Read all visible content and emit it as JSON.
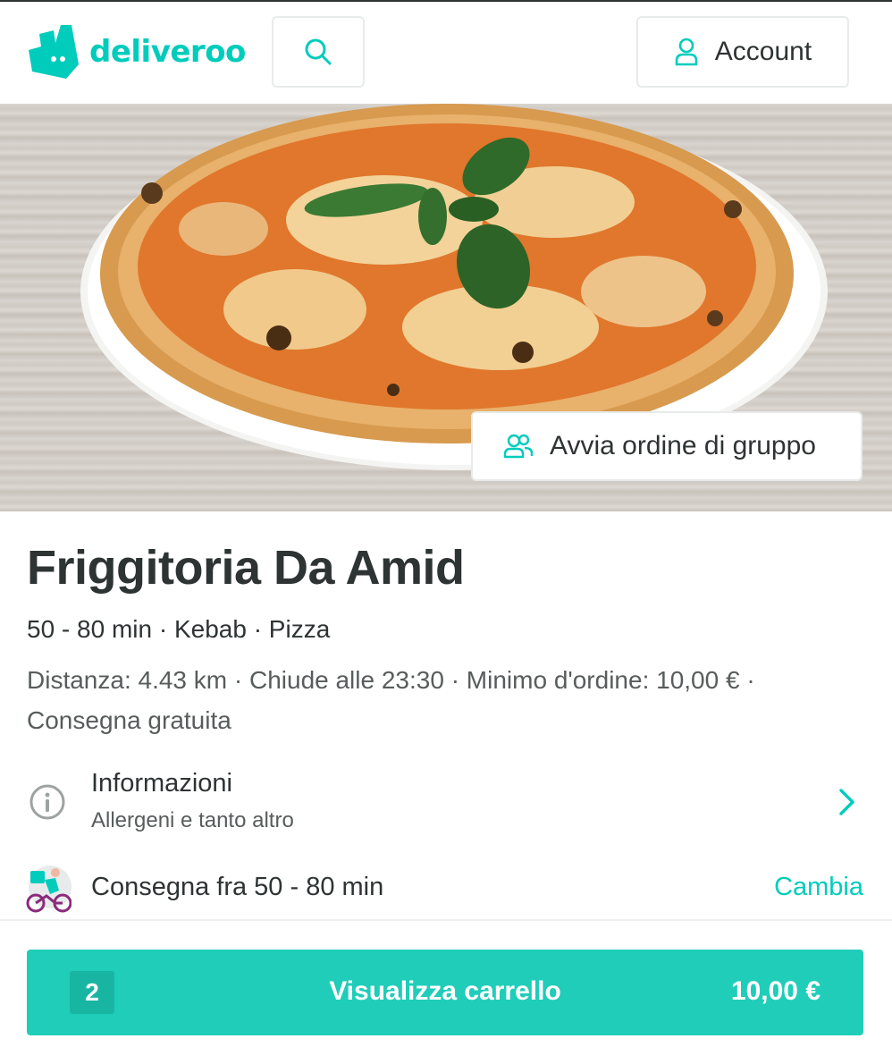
{
  "brand": {
    "name": "deliveroo",
    "accent": "#00ccbc"
  },
  "header": {
    "search_icon": "search-icon",
    "account_label": "Account",
    "account_icon": "user-icon"
  },
  "hero": {
    "image": "pizza-margherita-photo",
    "group_order_label": "Avvia ordine di gruppo",
    "group_icon": "users-icon"
  },
  "restaurant": {
    "name": "Friggitoria Da Amid",
    "meta": "50 - 80 min · Kebab · Pizza",
    "details": "Distanza: 4.43 km · Chiude alle 23:30 · Minimo d'ordine: 10,00 € · Consegna gratuita"
  },
  "info": {
    "title": "Informazioni",
    "subtitle": "Allergeni e tanto altro",
    "icon": "info-icon"
  },
  "delivery": {
    "text": "Consegna fra 50 - 80 min",
    "change_label": "Cambia",
    "icon": "rider-icon"
  },
  "cart": {
    "count": "2",
    "label": "Visualizza carrello",
    "total": "10,00 €",
    "color": "#1fcdb9"
  }
}
